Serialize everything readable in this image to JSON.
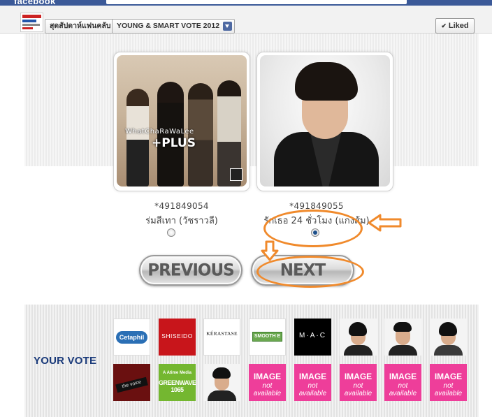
{
  "facebook": {
    "logo_text": "facebook"
  },
  "page_header": {
    "page_name": "สุดสัปดาห์แฟนคลับ",
    "app_name": "YOUNG & SMART VOTE 2012",
    "liked_label": "Liked"
  },
  "candidates": [
    {
      "number": "*491849054",
      "title": "ร่มสีเทา (วัชราวลี)",
      "photo_overlay": "WhatChaRaWaLee",
      "photo_overlay_plus": "+PLUS",
      "selected": false
    },
    {
      "number": "*491849055",
      "title": "รักเธอ 24 ชั่วโมง (แกงส้ม)",
      "selected": true
    }
  ],
  "navigation": {
    "previous_label": "PREVIOUS",
    "next_label": "NEXT"
  },
  "your_vote": {
    "heading": "YOUR VOTE",
    "thumbnails": [
      {
        "name": "cetaphil",
        "label": "Cetaphil"
      },
      {
        "name": "shiseido",
        "label": "SHISEIDO"
      },
      {
        "name": "kerastase",
        "label": "KÉRASTASE"
      },
      {
        "name": "smooth-e",
        "label": "SMOOTH E"
      },
      {
        "name": "mac",
        "label": "M·A·C"
      },
      {
        "name": "portrait-female-1"
      },
      {
        "name": "portrait-male-1"
      },
      {
        "name": "portrait-female-2"
      },
      {
        "name": "the-voice",
        "label": "the voice"
      },
      {
        "name": "greenwave",
        "label_small": "A Atime Media",
        "label_big": "GREENWAVE 1065"
      },
      {
        "name": "portrait-male-2"
      },
      {
        "name": "image-not-available",
        "line1": "IMAGE",
        "line2": "not available"
      },
      {
        "name": "image-not-available",
        "line1": "IMAGE",
        "line2": "not available"
      },
      {
        "name": "image-not-available",
        "line1": "IMAGE",
        "line2": "not available"
      },
      {
        "name": "image-not-available",
        "line1": "IMAGE",
        "line2": "not available"
      }
    ]
  },
  "colors": {
    "facebook_blue": "#3b5998",
    "annotation_orange": "#f08a2c",
    "vote_heading": "#1a3a7a",
    "not_available_pink": "#ee3e9a"
  }
}
